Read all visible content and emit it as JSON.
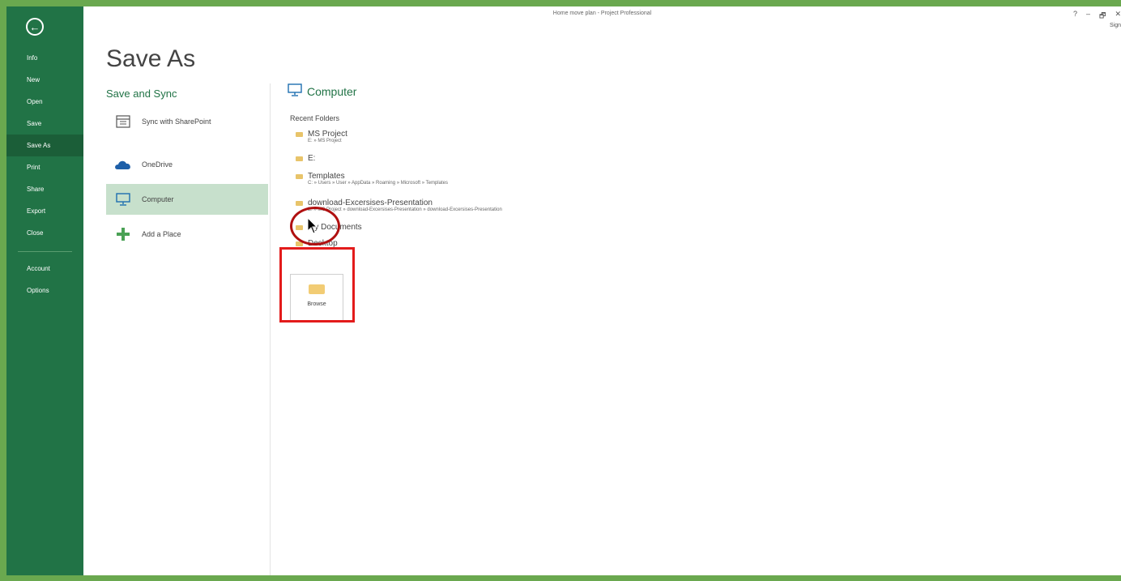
{
  "window": {
    "title": "Home move plan - Project Professional"
  },
  "titlebar": {
    "help": "?",
    "minimize": "–",
    "restore": "🗗",
    "close": "✕",
    "signin": "Sign"
  },
  "nav": {
    "items": [
      "Info",
      "New",
      "Open",
      "Save",
      "Save As",
      "Print",
      "Share",
      "Export",
      "Close"
    ],
    "bottom_items": [
      "Account",
      "Options"
    ],
    "active": "Save As"
  },
  "page": {
    "title": "Save As"
  },
  "left": {
    "section": "Save and Sync",
    "places": [
      {
        "label": "Sync with SharePoint",
        "icon": "sharepoint-icon"
      },
      {
        "label": "OneDrive",
        "icon": "cloud-icon"
      },
      {
        "label": "Computer",
        "icon": "computer-icon"
      },
      {
        "label": "Add a Place",
        "icon": "plus-icon"
      }
    ]
  },
  "right": {
    "heading": "Computer",
    "recent_label": "Recent Folders",
    "folders": [
      {
        "name": "MS Project",
        "path": "E: » MS Project"
      },
      {
        "name": "E:",
        "path": ""
      },
      {
        "name": "Templates",
        "path": "C: » Users » User » AppData » Roaming » Microsoft » Templates"
      },
      {
        "name": "download-Excersises-Presentation",
        "path": "E: » MS Project » download-Excersises-Presentation » download-Excersises-Presentation"
      },
      {
        "name": "My Documents",
        "path": ""
      },
      {
        "name": "Desktop",
        "path": ""
      }
    ],
    "browse_label": "Browse"
  },
  "colors": {
    "sidebar": "#217346",
    "accent": "#217346",
    "highlight": "#c7e0cc",
    "annotation": "#e31b1b"
  }
}
